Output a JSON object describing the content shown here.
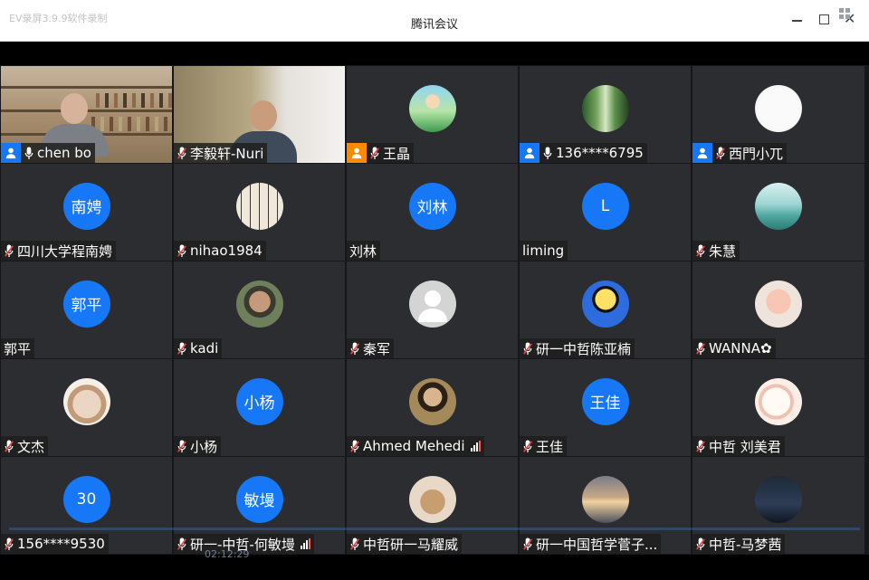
{
  "window": {
    "watermark": "EV录屏3.9.9软件录制",
    "title": "腾讯会议"
  },
  "player": {
    "timecode": "02:12:29"
  },
  "colors": {
    "tile_bg": "#2b2d31",
    "accent": "#1677f7",
    "active_border": "#2ea043",
    "cohost": "#ff8a00"
  },
  "participants": [
    {
      "name": "chen bo",
      "role": "host",
      "mic": "on",
      "media": "video"
    },
    {
      "name": "李毅轩-Nuri",
      "role": "",
      "mic": "muted",
      "media": "video"
    },
    {
      "name": "王晶",
      "role": "cohost",
      "mic": "muted",
      "media": "photo",
      "avatar_icon": "cartoon-girl-photo"
    },
    {
      "name": "136****6795",
      "role": "host",
      "mic": "on",
      "media": "photo",
      "avatar_icon": "forest-photo"
    },
    {
      "name": "西門小兀",
      "role": "host",
      "mic": "muted",
      "media": "photo",
      "avatar_icon": "i-love-inter-photo"
    },
    {
      "name": "四川大学程南娉",
      "role": "",
      "mic": "muted",
      "media": "text",
      "avatar_text": "南娉"
    },
    {
      "name": "nihao1984",
      "role": "",
      "mic": "muted",
      "media": "photo",
      "avatar_icon": "calligraphy-photo"
    },
    {
      "name": "刘林",
      "role": "",
      "mic": "",
      "media": "text",
      "avatar_text": "刘林"
    },
    {
      "name": "liming",
      "role": "",
      "mic": "",
      "media": "text",
      "avatar_text": "L"
    },
    {
      "name": "朱慧",
      "role": "",
      "mic": "muted",
      "media": "photo",
      "avatar_icon": "lake-photo"
    },
    {
      "name": "郭平",
      "role": "",
      "mic": "",
      "media": "text",
      "avatar_text": "郭平"
    },
    {
      "name": "kadi",
      "role": "",
      "mic": "muted",
      "media": "photo",
      "avatar_icon": "man-portrait-photo"
    },
    {
      "name": "秦军",
      "role": "",
      "mic": "muted",
      "media": "default",
      "avatar_icon": "default-user-icon"
    },
    {
      "name": "研一中哲陈亚楠",
      "role": "",
      "mic": "muted",
      "media": "photo",
      "avatar_icon": "cartoon-kid-photo"
    },
    {
      "name": "WANNA✿",
      "role": "",
      "mic": "muted",
      "media": "photo",
      "avatar_icon": "baby-photo"
    },
    {
      "name": "文杰",
      "role": "",
      "mic": "muted",
      "media": "photo",
      "avatar_icon": "bulldog-photo"
    },
    {
      "name": "小杨",
      "role": "",
      "mic": "muted",
      "media": "text",
      "avatar_text": "小杨"
    },
    {
      "name": "Ahmed Mehedi",
      "role": "",
      "mic": "muted",
      "media": "photo",
      "avatar_icon": "ancient-figure-photo",
      "signal": true
    },
    {
      "name": "王佳",
      "role": "",
      "mic": "muted",
      "media": "text",
      "avatar_text": "王佳"
    },
    {
      "name": "中哲 刘美君",
      "role": "",
      "mic": "muted",
      "media": "photo",
      "avatar_icon": "sheep-illustration-photo"
    },
    {
      "name": "156****9530",
      "role": "",
      "mic": "muted",
      "media": "text",
      "avatar_text": "30"
    },
    {
      "name": "研一-中哲-何敏墁",
      "role": "",
      "mic": "muted",
      "media": "text",
      "avatar_text": "敏墁",
      "signal": true
    },
    {
      "name": "中哲研一马耀威",
      "role": "",
      "mic": "muted",
      "media": "photo",
      "avatar_icon": "puppies-photo"
    },
    {
      "name": "研一中国哲学菅子...",
      "role": "",
      "mic": "muted",
      "media": "photo",
      "avatar_icon": "sunset-sea-photo"
    },
    {
      "name": "中哲-马梦茜",
      "role": "",
      "mic": "muted",
      "media": "photo",
      "avatar_icon": "dark-scene-photo"
    }
  ]
}
